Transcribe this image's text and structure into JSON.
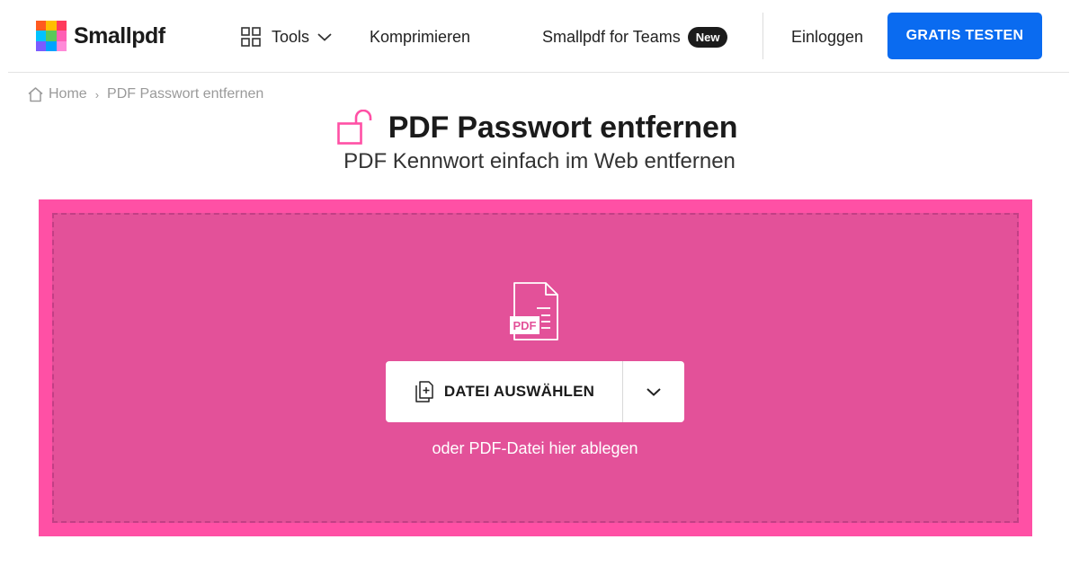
{
  "header": {
    "logo_text": "Smallpdf",
    "logo_colors": [
      "#ff5a1f",
      "#ffbf00",
      "#ff3b5c",
      "#00c2ff",
      "#5ac85a",
      "#ff5fb4",
      "#7a5cff",
      "#00a3ff",
      "#ff8ad8"
    ],
    "nav": {
      "tools_label": "Tools",
      "compress_label": "Komprimieren",
      "teams_label": "Smallpdf for Teams",
      "teams_badge": "New"
    },
    "login_label": "Einloggen",
    "cta_label": "GRATIS TESTEN",
    "cta_color": "#0a6bf0"
  },
  "breadcrumb": {
    "home_label": "Home",
    "separator": "›",
    "current_label": "PDF Passwort entfernen"
  },
  "hero": {
    "title": "PDF Passwort entfernen",
    "subtitle": "PDF Kennwort einfach im Web entfernen",
    "accent_color": "#ff50a5"
  },
  "dropzone": {
    "file_icon_label": "PDF",
    "choose_button_label": "DATEI AUSWÄHLEN",
    "hint": "oder PDF-Datei hier ablegen",
    "outer_color": "#ff50a5",
    "inner_color": "#e35199"
  },
  "icons": {
    "logo": "smallpdf-logo-icon",
    "tools": "grid-icon",
    "tools_chevron": "chevron-down-icon",
    "breadcrumb_home": "home-icon",
    "title": "unlock-icon",
    "file": "pdf-file-icon",
    "choose": "add-file-icon",
    "more": "chevron-down-icon"
  }
}
